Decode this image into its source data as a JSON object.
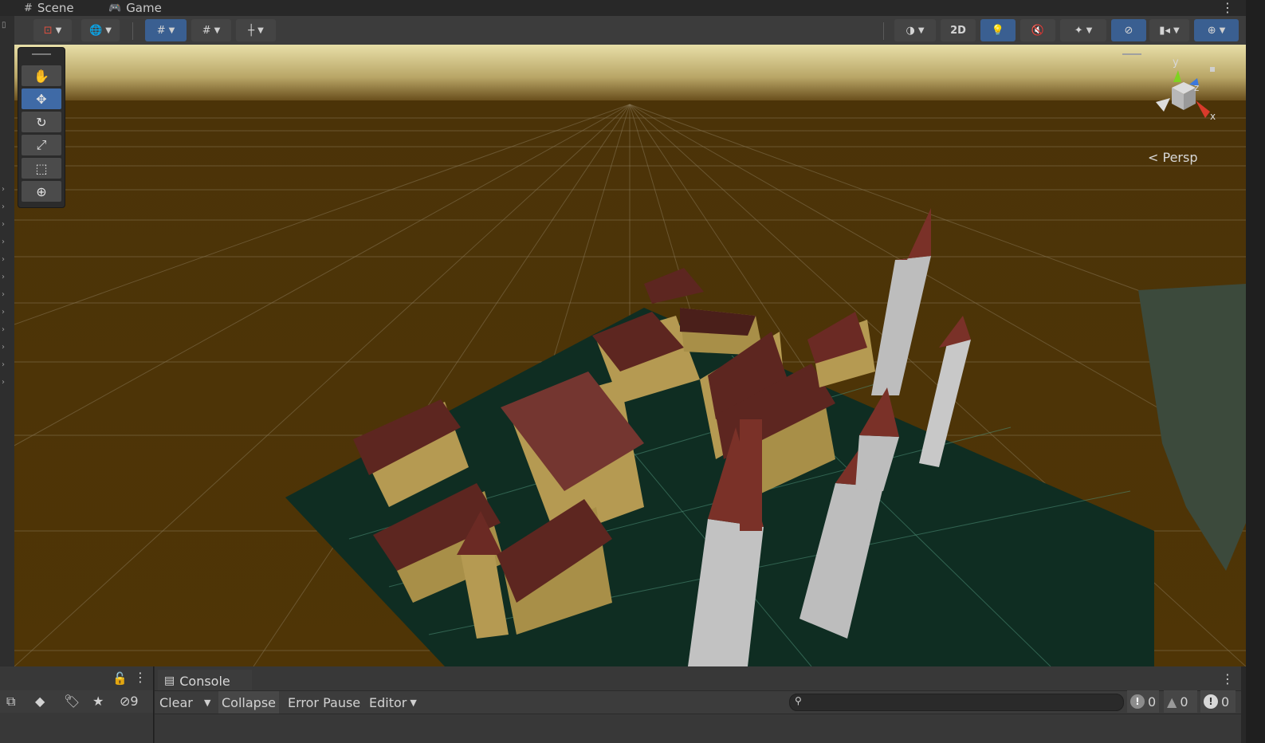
{
  "tabs": [
    {
      "label": "Scene",
      "icon": "grid-hash-icon"
    },
    {
      "label": "Game",
      "icon": "gamepad-icon"
    }
  ],
  "toolbar": {
    "two_d_label": "2D",
    "icons": [
      "draw-mode-icon",
      "global-icon",
      "grid-snap-icon",
      "increment-snap-icon",
      "ruler-grid-icon",
      "shading-sphere-icon",
      "lighting-bulb-icon",
      "audio-mute-icon",
      "effects-icon",
      "hidden-objects-icon",
      "camera-icon",
      "gizmos-icon"
    ]
  },
  "palette": {
    "tools": [
      "hand-tool",
      "move-tool",
      "rotate-tool",
      "scale-tool",
      "rect-tool",
      "transform-tool"
    ],
    "selected": "move-tool"
  },
  "gizmo": {
    "projection_label": "Persp",
    "axis_y": "y",
    "axis_z": "z",
    "axis_x": "x",
    "colors": {
      "y": "#7ed321",
      "z": "#3c78dc",
      "x": "#d93a2b"
    }
  },
  "scene": {
    "sky_color": "#d9cf9a",
    "ground_color": "#4d3407",
    "plane_color": "#0f2d22",
    "roof_color": "#6b2a24",
    "wall_color": "#b59a52",
    "tower_color": "#bdbdbd"
  },
  "left_panel": {
    "hidden_count": "9"
  },
  "console": {
    "tab_label": "Console",
    "clear_label": "Clear",
    "collapse_label": "Collapse",
    "error_pause_label": "Error Pause",
    "editor_label": "Editor",
    "search_placeholder": "",
    "info_count": "0",
    "warning_count": "0",
    "error_count": "0"
  }
}
